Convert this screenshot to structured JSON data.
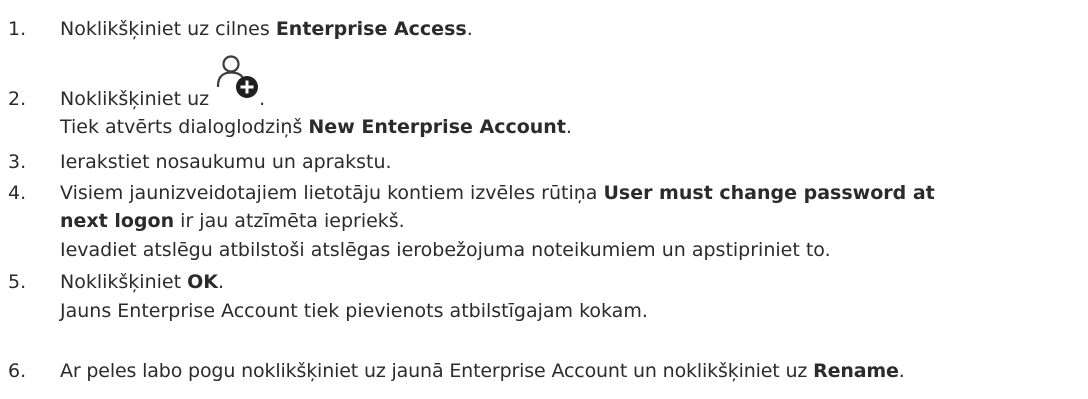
{
  "steps": [
    {
      "number": "1.",
      "before": "Noklikšķiniet uz cilnes ",
      "bold": "Enterprise Access",
      "after": "."
    },
    {
      "number": "2.",
      "before": "Noklikšķiniet uz ",
      "icon": "add-user-icon",
      "after": ".",
      "result_before": "Tiek atvērts dialoglodziņš ",
      "result_bold": "New Enterprise Account",
      "result_after": "."
    },
    {
      "number": "3.",
      "text": "Ierakstiet nosaukumu un aprakstu."
    },
    {
      "number": "4.",
      "before": "Visiem jaunizveidotajiem lietotāju kontiem izvēles rūtiņa ",
      "bold_line1": "User must change password at",
      "bold_line2": "next logon",
      "after": " ir jau atzīmēta iepriekš.",
      "result": "Ievadiet atslēgu atbilstoši atslēgas ierobežojuma noteikumiem un apstipriniet to."
    },
    {
      "number": "5.",
      "before": "Noklikšķiniet ",
      "bold": "OK",
      "after": ".",
      "result": "Jauns Enterprise Account tiek pievienots atbilstīgajam kokam."
    },
    {
      "number": "6.",
      "before": "Ar peles labo pogu noklikšķiniet uz jaunā Enterprise Account un noklikšķiniet uz ",
      "bold": "Rename",
      "after": "."
    }
  ]
}
